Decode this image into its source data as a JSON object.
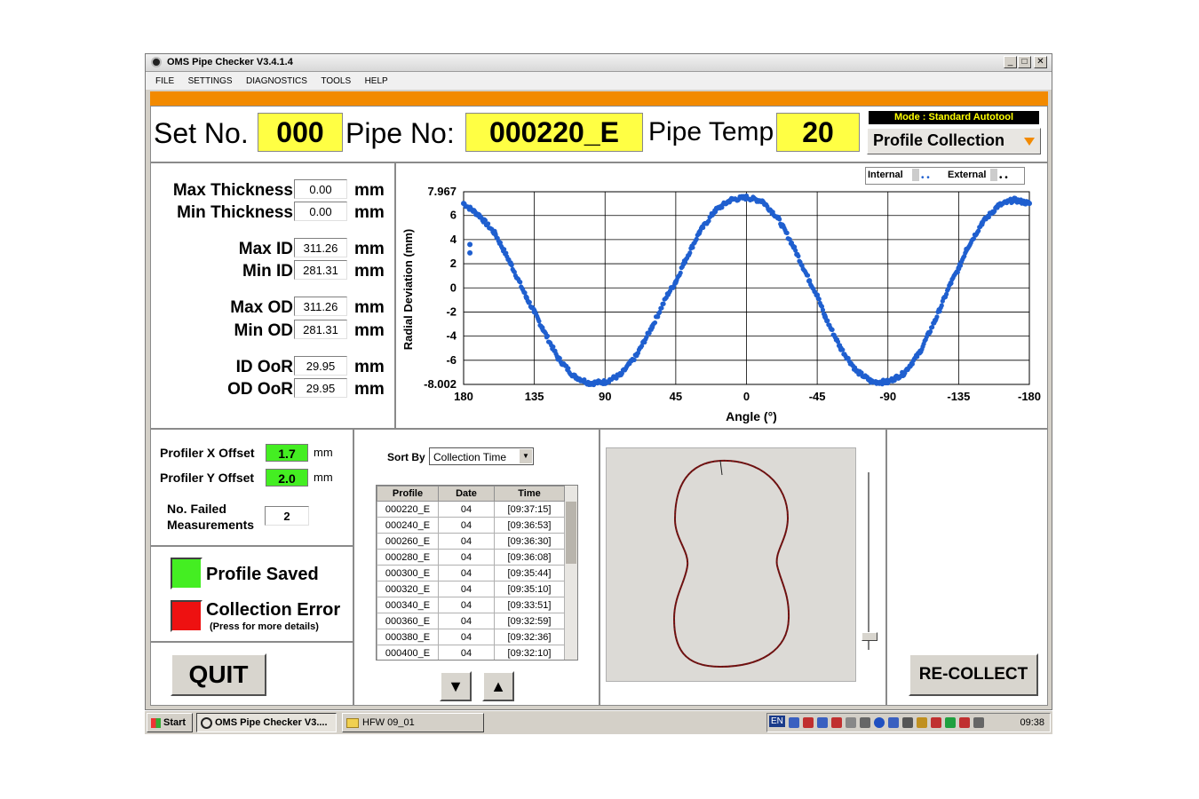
{
  "window": {
    "title": "OMS Pipe Checker V3.4.1.4",
    "min": "_",
    "max": "□",
    "close": "✕"
  },
  "menu": [
    "FILE",
    "SETTINGS",
    "DIAGNOSTICS",
    "TOOLS",
    "HELP"
  ],
  "header": {
    "set_label": "Set No.",
    "set_value": "000",
    "pipe_label": "Pipe No:",
    "pipe_value": "000220_E",
    "temp_label": "Pipe Temp",
    "temp_value": "20",
    "mode": "Mode : Standard Autotool",
    "collection_mode": "Profile Collection"
  },
  "stats": [
    {
      "label": "Max Thickness",
      "value": "0.00",
      "unit": "mm"
    },
    {
      "label": "Min Thickness",
      "value": "0.00",
      "unit": "mm"
    },
    {
      "label": "Max ID",
      "value": "311.26",
      "unit": "mm"
    },
    {
      "label": "Min ID",
      "value": "281.31",
      "unit": "mm"
    },
    {
      "label": "Max OD",
      "value": "311.26",
      "unit": "mm"
    },
    {
      "label": "Min OD",
      "value": "281.31",
      "unit": "mm"
    },
    {
      "label": "ID OoR",
      "value": "29.95",
      "unit": "mm"
    },
    {
      "label": "OD OoR",
      "value": "29.95",
      "unit": "mm"
    }
  ],
  "legend": {
    "internal": "Internal",
    "external": "External"
  },
  "offsets": {
    "x_label": "Profiler X Offset",
    "x_value": "1.7",
    "x_unit": "mm",
    "y_label": "Profiler Y Offset",
    "y_value": "2.0",
    "y_unit": "mm",
    "failed_label_1": "No. Failed",
    "failed_label_2": "Measurements",
    "failed_value": "2"
  },
  "status": {
    "saved_label": "Profile Saved",
    "saved_color": "#44ee22",
    "error_label": "Collection Error",
    "error_sub": "(Press for more details)",
    "error_color": "#ee1111"
  },
  "buttons": {
    "quit": "QUIT",
    "recollect": "RE-COLLECT",
    "down": "▼",
    "up": "▲"
  },
  "sort": {
    "label": "Sort By",
    "value": "Collection Time"
  },
  "table": {
    "headers": [
      "Profile",
      "Date",
      "Time"
    ],
    "rows": [
      [
        "000220_E",
        "04",
        "[09:37:15]"
      ],
      [
        "000240_E",
        "04",
        "[09:36:53]"
      ],
      [
        "000260_E",
        "04",
        "[09:36:30]"
      ],
      [
        "000280_E",
        "04",
        "[09:36:08]"
      ],
      [
        "000300_E",
        "04",
        "[09:35:44]"
      ],
      [
        "000320_E",
        "04",
        "[09:35:10]"
      ],
      [
        "000340_E",
        "04",
        "[09:33:51]"
      ],
      [
        "000360_E",
        "04",
        "[09:32:59]"
      ],
      [
        "000380_E",
        "04",
        "[09:32:36]"
      ],
      [
        "000400_E",
        "04",
        "[09:32:10]"
      ]
    ]
  },
  "taskbar": {
    "start": "Start",
    "task1": "OMS Pipe Checker V3....",
    "task2": "HFW 09_01",
    "lang": "EN",
    "clock": "09:38"
  },
  "chart_data": {
    "type": "scatter",
    "xlabel": "Angle (°)",
    "ylabel": "Radial Deviation (mm)",
    "xlim": [
      180,
      -180
    ],
    "ylim": [
      -8.002,
      7.967
    ],
    "x_ticks": [
      180,
      135,
      90,
      45,
      0,
      -45,
      -90,
      -135,
      -180
    ],
    "y_ticks": [
      "7.967",
      "6",
      "4",
      "2",
      "0",
      "-2",
      "-4",
      "-6",
      "-8.002"
    ],
    "y_tick_values": [
      7.967,
      6,
      4,
      2,
      0,
      -2,
      -4,
      -6,
      -8.002
    ],
    "grid": true,
    "color": "#1f5fcf",
    "series": [
      {
        "x": [
          180,
          170,
          160,
          150,
          140,
          135,
          130,
          120,
          110,
          100,
          90,
          80,
          70,
          60,
          50,
          45,
          40,
          30,
          20,
          10,
          0,
          -10,
          -20,
          -30,
          -40,
          -45,
          -50,
          -60,
          -70,
          -80,
          -90,
          -100,
          -110,
          -120,
          -130,
          -135,
          -140,
          -150,
          -160,
          -170,
          -180
        ],
        "y": [
          7.0,
          6.0,
          4.5,
          2.0,
          -0.8,
          -2.0,
          -3.3,
          -5.8,
          -7.3,
          -7.9,
          -7.8,
          -7.2,
          -5.6,
          -3.2,
          -0.5,
          0.5,
          2.0,
          4.6,
          6.4,
          7.3,
          7.5,
          7.2,
          5.8,
          3.4,
          0.6,
          -0.6,
          -2.4,
          -5.0,
          -6.9,
          -7.8,
          -7.8,
          -7.1,
          -5.4,
          -2.7,
          0.4,
          1.6,
          3.2,
          5.4,
          6.8,
          7.3,
          7.0
        ]
      }
    ],
    "outliers": {
      "x": [
        176,
        176
      ],
      "y": [
        3.6,
        2.9
      ]
    }
  }
}
